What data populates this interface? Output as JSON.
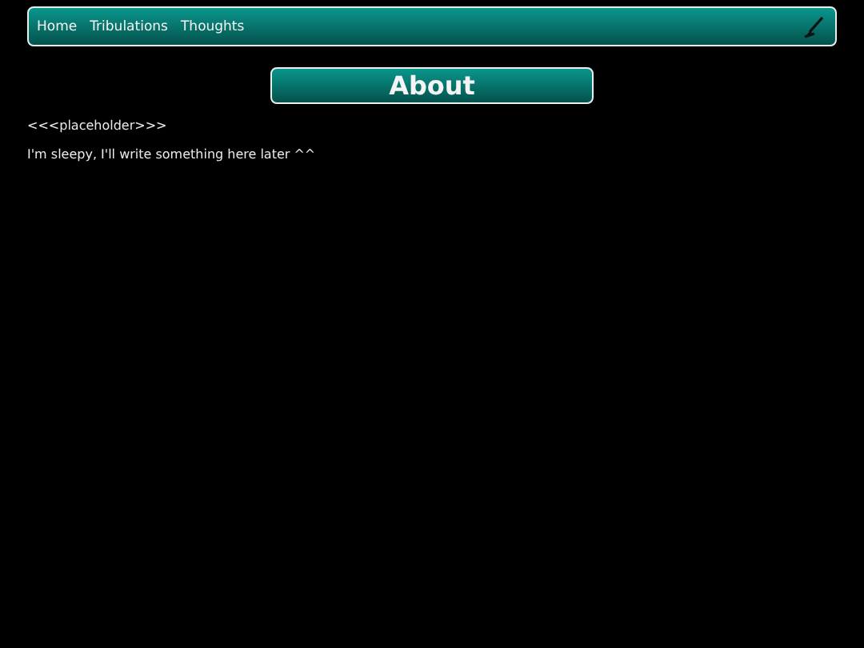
{
  "nav": {
    "links": [
      {
        "label": "Home"
      },
      {
        "label": "Tribulations"
      },
      {
        "label": "Thoughts"
      }
    ]
  },
  "heading": "About",
  "paragraphs": [
    "<<<placeholder>>>",
    "I'm sleepy, I'll write something here later ^^"
  ]
}
